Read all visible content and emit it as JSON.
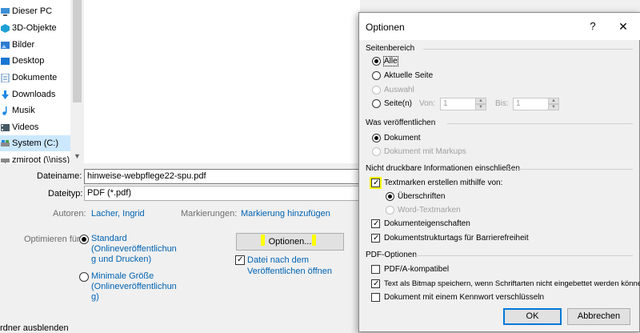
{
  "nav": {
    "items": [
      {
        "label": "Dieser PC",
        "icon": "computer-icon"
      },
      {
        "label": "3D-Objekte",
        "icon": "3d-objects-icon"
      },
      {
        "label": "Bilder",
        "icon": "pictures-icon"
      },
      {
        "label": "Desktop",
        "icon": "desktop-icon"
      },
      {
        "label": "Dokumente",
        "icon": "documents-icon"
      },
      {
        "label": "Downloads",
        "icon": "downloads-icon"
      },
      {
        "label": "Musik",
        "icon": "music-icon"
      },
      {
        "label": "Videos",
        "icon": "videos-icon"
      },
      {
        "label": "System (C:)",
        "icon": "drive-icon"
      },
      {
        "label": "zmiroot (\\\\niss) (",
        "icon": "network-drive-icon"
      }
    ]
  },
  "form": {
    "filename_label": "Dateiname:",
    "filename_value": "hinweise-webpflege22-spu.pdf",
    "filetype_label": "Dateityp:",
    "filetype_value": "PDF (*.pdf)",
    "authors_label": "Autoren:",
    "authors_value": "Lacher, Ingrid",
    "tags_label": "Markierungen:",
    "tags_value": "Markierung hinzufügen",
    "optimize_label": "Optimieren für:",
    "optimize_standard": [
      "Standard",
      "(Onlineveröffentlichun",
      "g und Drucken)"
    ],
    "optimize_minimal": [
      "Minimale Größe",
      "(Onlineveröffentlichun",
      "g)"
    ],
    "options_button": "Optionen...",
    "open_after": [
      "Datei nach dem",
      "Veröffentlichen öffnen"
    ],
    "hide_folders": "rdner ausblenden"
  },
  "options": {
    "title": "Optionen",
    "help": "?",
    "close": "✕",
    "page_range": {
      "title": "Seitenbereich",
      "all": "Alle",
      "current": "Aktuelle Seite",
      "selection": "Auswahl",
      "pages": "Seite(n)",
      "from_label": "Von:",
      "from_value": "1",
      "to_label": "Bis:",
      "to_value": "1"
    },
    "publish": {
      "title": "Was veröffentlichen",
      "document": "Dokument",
      "document_markups": "Dokument mit Markups"
    },
    "nonprint": {
      "title": "Nicht druckbare Informationen einschließen",
      "bookmarks": "Textmarken erstellen mithilfe von:",
      "headings": "Überschriften",
      "word_bookmarks": "Word-Textmarken",
      "doc_properties": "Dokumenteigenschaften",
      "structure_tags": "Dokumentstrukturtags für Barrierefreiheit"
    },
    "pdf": {
      "title": "PDF-Optionen",
      "pdfa": "PDF/A-kompatibel",
      "bitmap": "Text als Bitmap speichern, wenn Schriftarten nicht eingebettet werden können",
      "encrypt": "Dokument mit einem Kennwort verschlüsseln"
    },
    "ok": "OK",
    "cancel": "Abbrechen"
  },
  "colors": {
    "accent": "#0063b1",
    "highlight": "#ffff00",
    "selection": "#cce8ff"
  }
}
